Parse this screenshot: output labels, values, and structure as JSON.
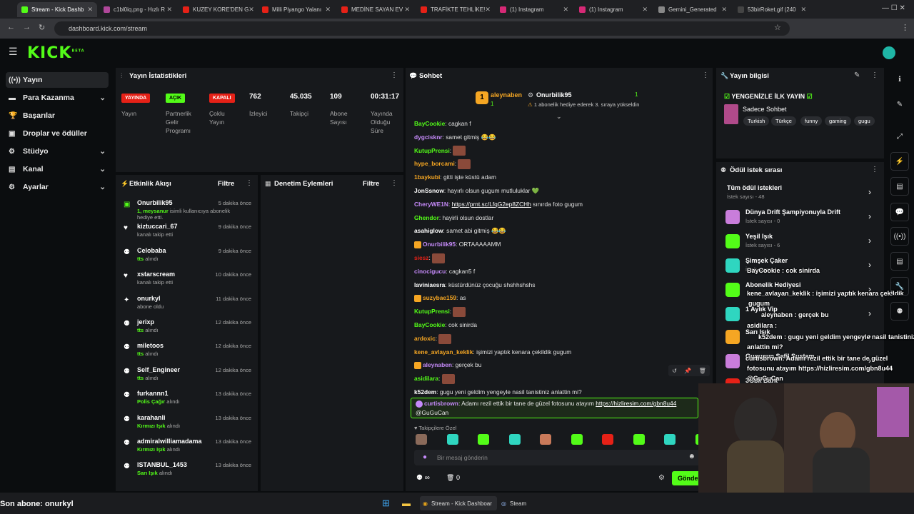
{
  "browser": {
    "tabs": [
      {
        "label": "Stream - Kick Dashb",
        "color": "#53fc18",
        "active": true
      },
      {
        "label": "c1bl0iq.png - Hızlı R",
        "color": "#b0479a"
      },
      {
        "label": "KUZEY KORE'DEN G",
        "color": "#e62117"
      },
      {
        "label": "Milli Piyango Yalanı",
        "color": "#e62117"
      },
      {
        "label": "MEDİNE SAYAN EV",
        "color": "#e62117"
      },
      {
        "label": "TRAFİKTE TEHLİKE!",
        "color": "#e62117"
      },
      {
        "label": "(1) Instagram",
        "color": "#d62976"
      },
      {
        "label": "(1) Instagram",
        "color": "#d62976"
      },
      {
        "label": "Gemini_Generated",
        "color": "#888"
      },
      {
        "label": "53birRoket.gif (240",
        "color": "#444"
      }
    ],
    "url": "dashboard.kick.com/stream"
  },
  "logo": "KICK",
  "logo_beta": "BETA",
  "sidebar": [
    {
      "label": "Yayın",
      "icon": "broadcast-icon",
      "glyph": "((•))",
      "active": true
    },
    {
      "label": "Para Kazanma",
      "icon": "money-icon",
      "glyph": "▬",
      "chev": true
    },
    {
      "label": "Başarılar",
      "icon": "trophy-icon",
      "glyph": "🏆"
    },
    {
      "label": "Droplar ve ödüller",
      "icon": "gift-icon",
      "glyph": "▣"
    },
    {
      "label": "Stüdyo",
      "icon": "studio-icon",
      "glyph": "⚙",
      "chev": true
    },
    {
      "label": "Kanal",
      "icon": "channel-icon",
      "glyph": "▤",
      "chev": true
    },
    {
      "label": "Ayarlar",
      "icon": "settings-icon",
      "glyph": "⚙",
      "chev": true
    }
  ],
  "stats": {
    "title": "Yayın İstatistikleri",
    "items": [
      {
        "badge": "YAYINDA",
        "label": "Yayın"
      },
      {
        "badge": "AÇIK",
        "label": "Partnerlik Gelir Programı"
      },
      {
        "badge": "KAPALI",
        "label": "Çoklu Yayın"
      },
      {
        "value": "762",
        "label": "İzleyici"
      },
      {
        "value": "45.035",
        "label": "Takipçi"
      },
      {
        "value": "109",
        "label": "Abone Sayısı"
      },
      {
        "value": "00:31:17",
        "label": "Yayında Olduğu Süre"
      }
    ]
  },
  "activity": {
    "title": "Etkinlik Akışı",
    "filter": "Filtre",
    "items": [
      {
        "name": "Onurbilik95",
        "time": "5 dakika önce",
        "sub_hl": "1, meysanur",
        "sub": " isimli kullanıcıya abonelik hediye etti.",
        "icon": "gift-icon",
        "g": "▣"
      },
      {
        "name": "kiztuccari_67",
        "time": "9 dakika önce",
        "sub_hl": "",
        "sub": "kanalı takip etti",
        "icon": "heart-icon",
        "g": "♥"
      },
      {
        "name": "Celobaba",
        "time": "9 dakika önce",
        "sub_hl": "tts",
        "sub": " alındı",
        "icon": "reward-icon",
        "g": "⚉"
      },
      {
        "name": "xstarscream",
        "time": "10 dakika önce",
        "sub_hl": "",
        "sub": "kanalı takip etti",
        "icon": "heart-icon",
        "g": "♥"
      },
      {
        "name": "onurkyl",
        "time": "11 dakika önce",
        "sub_hl": "",
        "sub": "abone oldu",
        "icon": "star-icon",
        "g": "✦"
      },
      {
        "name": "jerixp",
        "time": "12 dakika önce",
        "sub_hl": "tts",
        "sub": " alındı",
        "icon": "reward-icon",
        "g": "⚉"
      },
      {
        "name": "miletoos",
        "time": "12 dakika önce",
        "sub_hl": "tts",
        "sub": " alındı",
        "icon": "reward-icon",
        "g": "⚉"
      },
      {
        "name": "Self_Engineer",
        "time": "12 dakika önce",
        "sub_hl": "tts",
        "sub": " alındı",
        "icon": "reward-icon",
        "g": "⚉"
      },
      {
        "name": "furkannn1",
        "time": "13 dakika önce",
        "sub_hl": "Polis Çağır",
        "sub": " alındı",
        "icon": "reward-icon",
        "g": "⚉"
      },
      {
        "name": "karahanli",
        "time": "13 dakika önce",
        "sub_hl": "Kırmızı Işık",
        "sub": " alındı",
        "icon": "reward-icon",
        "g": "⚉"
      },
      {
        "name": "admiralwilliamadama",
        "time": "13 dakika önce",
        "sub_hl": "Kırmızı Işık",
        "sub": " alındı",
        "icon": "reward-icon",
        "g": "⚉"
      },
      {
        "name": "ISTANBUL_1453",
        "time": "13 dakika önce",
        "sub_hl": "Sarı Işık",
        "sub": " alındı",
        "icon": "reward-icon",
        "g": "⚉"
      }
    ]
  },
  "moderation": {
    "title": "Denetim Eylemleri",
    "filter": "Filtre"
  },
  "chat": {
    "title": "Sohbet",
    "pinned": {
      "user1": "aleynaben",
      "user2": "Onurbilik95",
      "count1": "1",
      "count2": "1",
      "text": "1 abonelik hediye ederek 3. sıraya yükseldin"
    },
    "messages": [
      {
        "user": "BayCookie",
        "color": "#53fc18",
        "text": "cagkan f"
      },
      {
        "user": "dygcisknr",
        "color": "#c58af9",
        "text": "samet gitmiş 😂😂"
      },
      {
        "user": "KutupPrensi",
        "color": "#53fc18",
        "text": "",
        "emote": true
      },
      {
        "user": "hype_borcami",
        "color": "#f5a623",
        "text": "",
        "emote": true
      },
      {
        "user": "1baykubi",
        "color": "#f5a623",
        "text": "gitti işte küstü adam"
      },
      {
        "user": "JonSsnow",
        "color": "#ffffff",
        "text": "hayırlı olsun gugum mutluluklar 💚"
      },
      {
        "user": "CheryWE1N",
        "color": "#c58af9",
        "text": "",
        "link": "https://prnt.sc/LfqG2ep8ZCHh",
        "after": " sınırda foto gugum"
      },
      {
        "user": "Ghendor",
        "color": "#53fc18",
        "text": "hayirli olsun dostlar"
      },
      {
        "user": "asahiglow",
        "color": "#ffffff",
        "text": "samet abi gitmiş 😂😂"
      },
      {
        "user": "Onurbilik95",
        "color": "#c58af9",
        "text": "ORTAAAAAMM"
      },
      {
        "user": "siesz",
        "color": "#e62117",
        "text": "",
        "emote": true
      },
      {
        "user": "cinocigucu",
        "color": "#c58af9",
        "text": "cagkan5 f"
      },
      {
        "user": "laviniaesra",
        "color": "#ffffff",
        "text": "küstürdünüz çocuğu shshhshshs"
      },
      {
        "user": "suzybae159",
        "color": "#f5a623",
        "text": "as"
      },
      {
        "user": "KutupPrensi",
        "color": "#53fc18",
        "text": "",
        "emote": true
      },
      {
        "user": "BayCookie",
        "color": "#53fc18",
        "text": "cok sinirda"
      },
      {
        "user": "ardoxic",
        "color": "#f5a623",
        "text": "",
        "emote": true
      },
      {
        "user": "kene_avlayan_keklik",
        "color": "#f5a623",
        "text": "işimizi yaptık kenara çekildik gugum"
      },
      {
        "user": "aleynaben",
        "color": "#c58af9",
        "text": "gerçek bu"
      },
      {
        "user": "asidilara",
        "color": "#53fc18",
        "text": "",
        "emote": true
      },
      {
        "user": "k52dem",
        "color": "#ffffff",
        "text": "gugu yeni geldim yengeyle nasil tanistiniz anlattin mi?"
      }
    ],
    "highlight": {
      "user": "curtisbrown",
      "text": "Adamı rezil ettik bir tane de güzel fotosunu atayım ",
      "link": "https://hizliresim.com/gbn8u44",
      "line2": "@GuGuCan"
    },
    "followers_only": "Takipçilere Özel",
    "input_placeholder": "Bir mesaj gönderin",
    "points": "∞",
    "gift_count": "0",
    "send": "Gönder"
  },
  "stream_info": {
    "title": "Yayın bilgisi",
    "stream_title": "YENGENİZLE İLK YAYIN",
    "category": "Sadece Sohbet",
    "tags": [
      "Turkish",
      "Türkçe",
      "funny",
      "gaming",
      "gugu"
    ]
  },
  "rewards": {
    "title": "Ödül istek sırası",
    "items": [
      {
        "title": "Tüm ödül istekleri",
        "sub": "İstek sayısı - 48",
        "color": ""
      },
      {
        "title": "Dünya Drift Şampiyonuyla Drift",
        "sub": "İstek sayısı - 0",
        "color": "#c97ddb"
      },
      {
        "title": "Yeşil Işık",
        "sub": "İstek sayısı - 6",
        "color": "#53fc18"
      },
      {
        "title": "Şimşek Çaker",
        "sub": "İstek sayısı",
        "color": "#2fd6c0"
      },
      {
        "title": "Abonelik Hediyesi",
        "sub": "",
        "color": "#53fc18"
      },
      {
        "title": "1 Aylık Vip",
        "sub": "",
        "color": "#2fd6c0"
      },
      {
        "title": "Sarı Işık",
        "sub": "",
        "color": "#f5a623"
      },
      {
        "title": "Gugunun Sefil Sustam",
        "sub": "",
        "color": "#c97ddb"
      },
      {
        "title": "3Gbk Bark",
        "sub": "",
        "color": "#e62117"
      }
    ]
  },
  "overlay": {
    "lines": [
      "BayCookie : cok sinirda",
      "kene_avlayan_keklik : işimizi yaptık kenara çekildik",
      "gugum",
      "aleynaben : gerçek bu",
      "asidilara :",
      "k52dem : gugu yeni geldim yengeyle nasil tanistiniz",
      "anlattin mi?",
      "curtisbrown: Adamı rezil ettik bir tane de güzel",
      "fotosunu atayım https://hizliresim.com/gbn8u44",
      "@GuGuCan"
    ],
    "last_sub": "Son abone: onurkyl"
  },
  "taskbar": {
    "app1": "Stream - Kick Dashboar",
    "app2": "Steam"
  }
}
